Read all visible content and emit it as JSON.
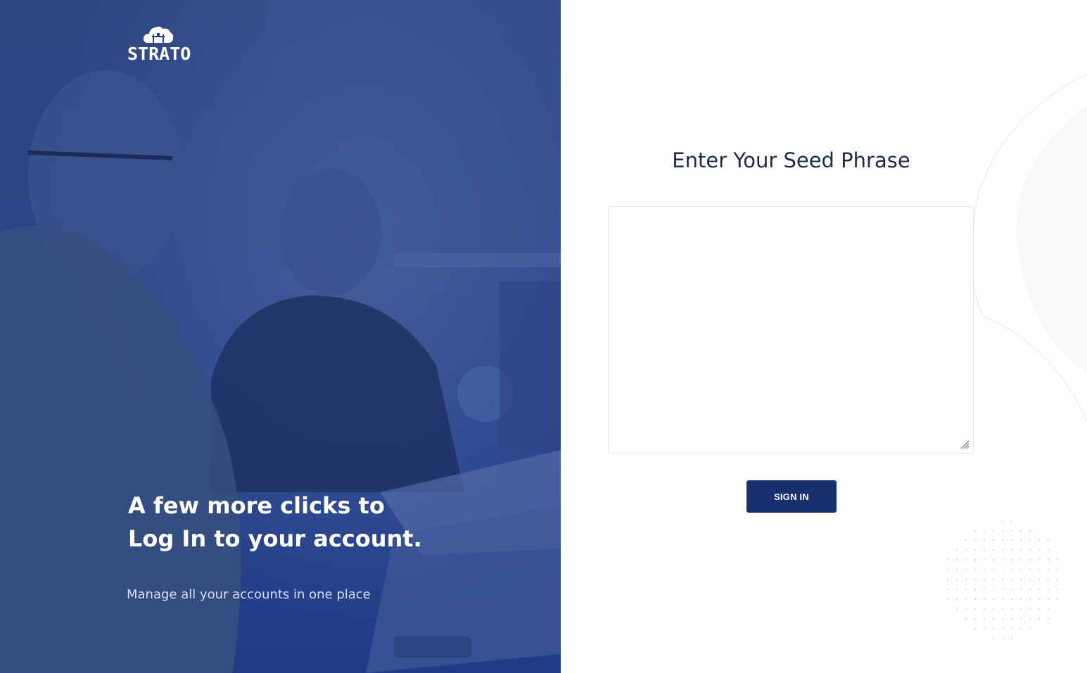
{
  "brand": {
    "logo_text": "STRATO",
    "cloud_icon": "cloud-building-icon"
  },
  "hero": {
    "headline_line1": "A few more clicks to",
    "headline_line2": "Log In to your account.",
    "tagline": "Manage all your accounts in one place"
  },
  "login": {
    "title": "Enter Your Seed Phrase",
    "seed_value": "",
    "seed_placeholder": "",
    "submit_label": "SIGN IN"
  },
  "colors": {
    "brand_overlay": "#2a4386",
    "button": "#183070",
    "title_text": "#1e2b45",
    "tagline_text": "#d5ddf0"
  }
}
